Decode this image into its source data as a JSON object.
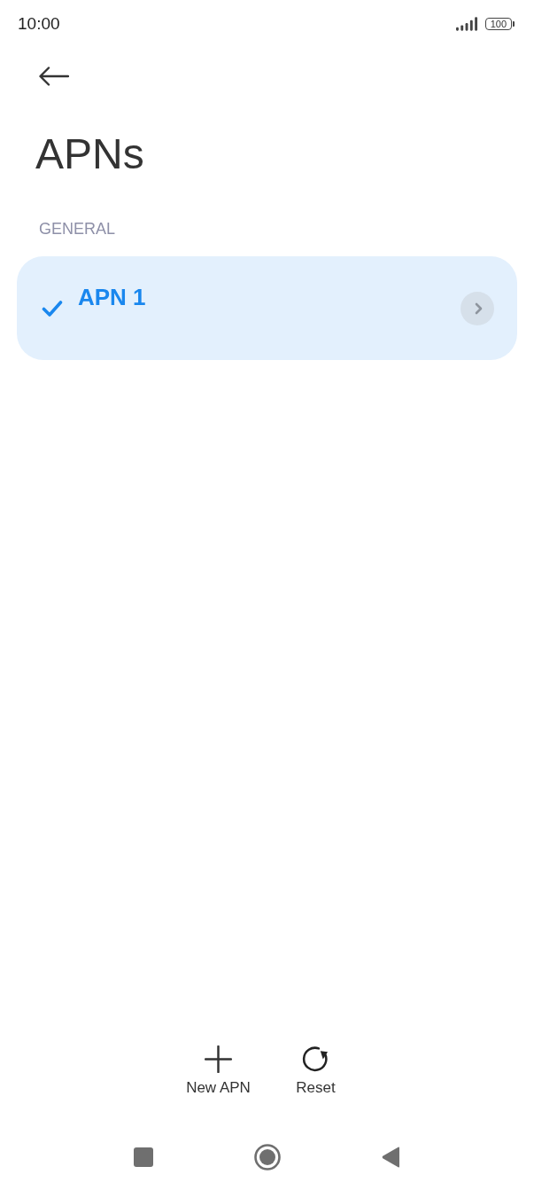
{
  "status_bar": {
    "time": "10:00",
    "battery": "100"
  },
  "header": {
    "title": "APNs"
  },
  "section": {
    "label": "GENERAL",
    "items": [
      {
        "name": "APN 1",
        "selected": true
      }
    ]
  },
  "actions": [
    {
      "kind": "add",
      "label": "New APN"
    },
    {
      "kind": "reset",
      "label": "Reset"
    }
  ]
}
